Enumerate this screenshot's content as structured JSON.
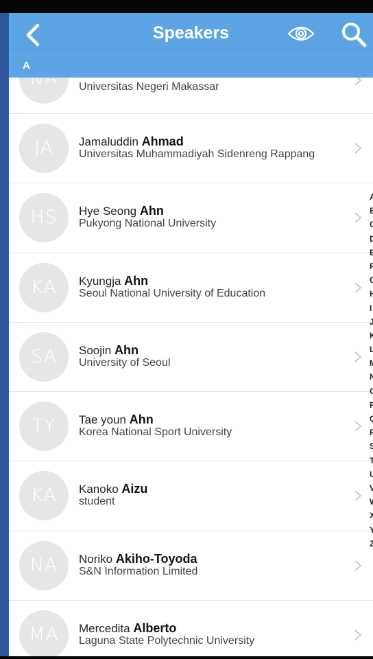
{
  "navbar": {
    "title": "Speakers",
    "back_icon": "chevron-left-icon",
    "view_icon": "eye-icon",
    "search_icon": "search-icon",
    "color": "#5ca4e4"
  },
  "section": {
    "letter": "A"
  },
  "speakers": [
    {
      "initials": "NA",
      "first": "",
      "last": "",
      "affiliation": "Universitas Negeri Makassar",
      "partial": true
    },
    {
      "initials": "JA",
      "first": "Jamaluddin",
      "last": "Ahmad",
      "affiliation": "Universitas Muhammadiyah Sidenreng Rappang"
    },
    {
      "initials": "HS",
      "first": "Hye Seong",
      "last": "Ahn",
      "affiliation": "Pukyong National University"
    },
    {
      "initials": "KA",
      "first": "Kyungja",
      "last": "Ahn",
      "affiliation": "Seoul National University of Education"
    },
    {
      "initials": "SA",
      "first": "Soojin",
      "last": "Ahn",
      "affiliation": "University of Seoul"
    },
    {
      "initials": "TY",
      "first": "Tae youn",
      "last": "Ahn",
      "affiliation": "Korea National Sport University"
    },
    {
      "initials": "KA",
      "first": "Kanoko",
      "last": "Aizu",
      "affiliation": "student"
    },
    {
      "initials": "NA",
      "first": "Noriko",
      "last": "Akiho-Toyoda",
      "affiliation": "S&N Information Limited"
    },
    {
      "initials": "MA",
      "first": "Mercedita",
      "last": "Alberto",
      "affiliation": "Laguna State Polytechnic University"
    }
  ],
  "index_letters": [
    "A",
    "B",
    "C",
    "D",
    "E",
    "F",
    "G",
    "H",
    "I",
    "J",
    "K",
    "L",
    "M",
    "N",
    "O",
    "P",
    "Q",
    "R",
    "S",
    "T",
    "U",
    "V",
    "W",
    "X",
    "Y",
    "Z"
  ]
}
